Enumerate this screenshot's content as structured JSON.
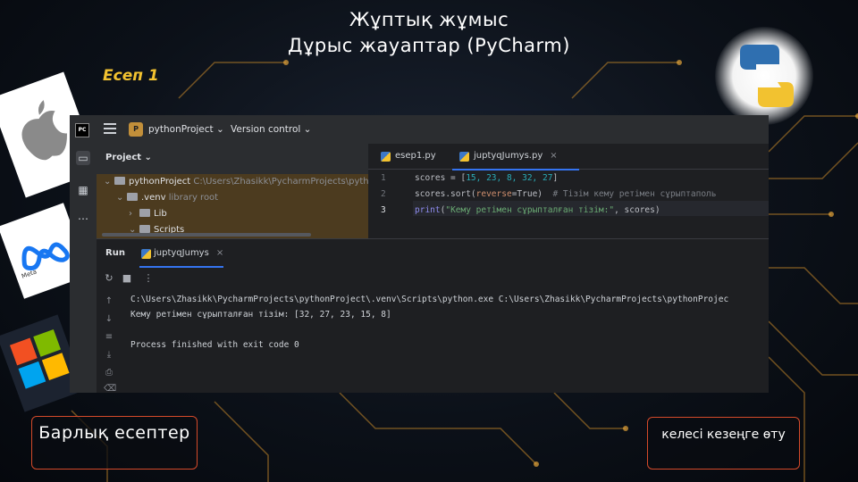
{
  "slide": {
    "title_line1": "Жұптық жұмыс",
    "title_line2": "Дұрыс жауаптар (PyCharm)",
    "task_label": "Есеп 1"
  },
  "ide": {
    "logo": "PC",
    "project_badge": "P",
    "project_name": "pythonProject ⌄",
    "version_control": "Version control ⌄",
    "project_pane_title": "Project ⌄",
    "tree": [
      {
        "arrow": "⌄",
        "name": "pythonProject",
        "extra": " C:\\Users\\Zhasikk\\PycharmProjects\\pyth"
      },
      {
        "arrow": "⌄",
        "name": ".venv",
        "extra": " library root"
      },
      {
        "arrow": "›",
        "name": "Lib",
        "extra": ""
      },
      {
        "arrow": "⌄",
        "name": "Scripts",
        "extra": ""
      }
    ],
    "editor_tabs": [
      {
        "label": "esep1.py",
        "active": false
      },
      {
        "label": "juptyqJumys.py",
        "active": true
      }
    ],
    "line_numbers": [
      "1",
      "2",
      "3"
    ],
    "code": {
      "l1_a": "scores = [",
      "l1_nums": "15, 23, 8, 32, 27",
      "l1_b": "]",
      "l2_a": "scores.sort(",
      "l2_param": "reverse",
      "l2_b": "=True)  ",
      "l2_cmt": "# Тізім кему ретімен сұрыптаполь",
      "l3_fn": "print",
      "l3_a": "(",
      "l3_str": "\"Кему ретімен сұрыпталған тізім:\"",
      "l3_b": ", scores)"
    },
    "run_label": "Run",
    "run_tab": "juptyqJumys",
    "console": [
      "C:\\Users\\Zhasikk\\PycharmProjects\\pythonProject\\.venv\\Scripts\\python.exe C:\\Users\\Zhasikk\\PycharmProjects\\pythonProjec",
      "Кему ретімен сұрыпталған тізім: [32, 27, 23, 15, 8]",
      "",
      "Process finished with exit code 0"
    ]
  },
  "nav": {
    "all_tasks": "Барлық есептер",
    "next_stage": "келесі кезеңге өту"
  },
  "logos": {
    "meta_text": "Meta"
  },
  "colors": {
    "accent_yellow": "#f2c230",
    "button_border": "#d44a2a",
    "ide_bg": "#1e1f22"
  }
}
